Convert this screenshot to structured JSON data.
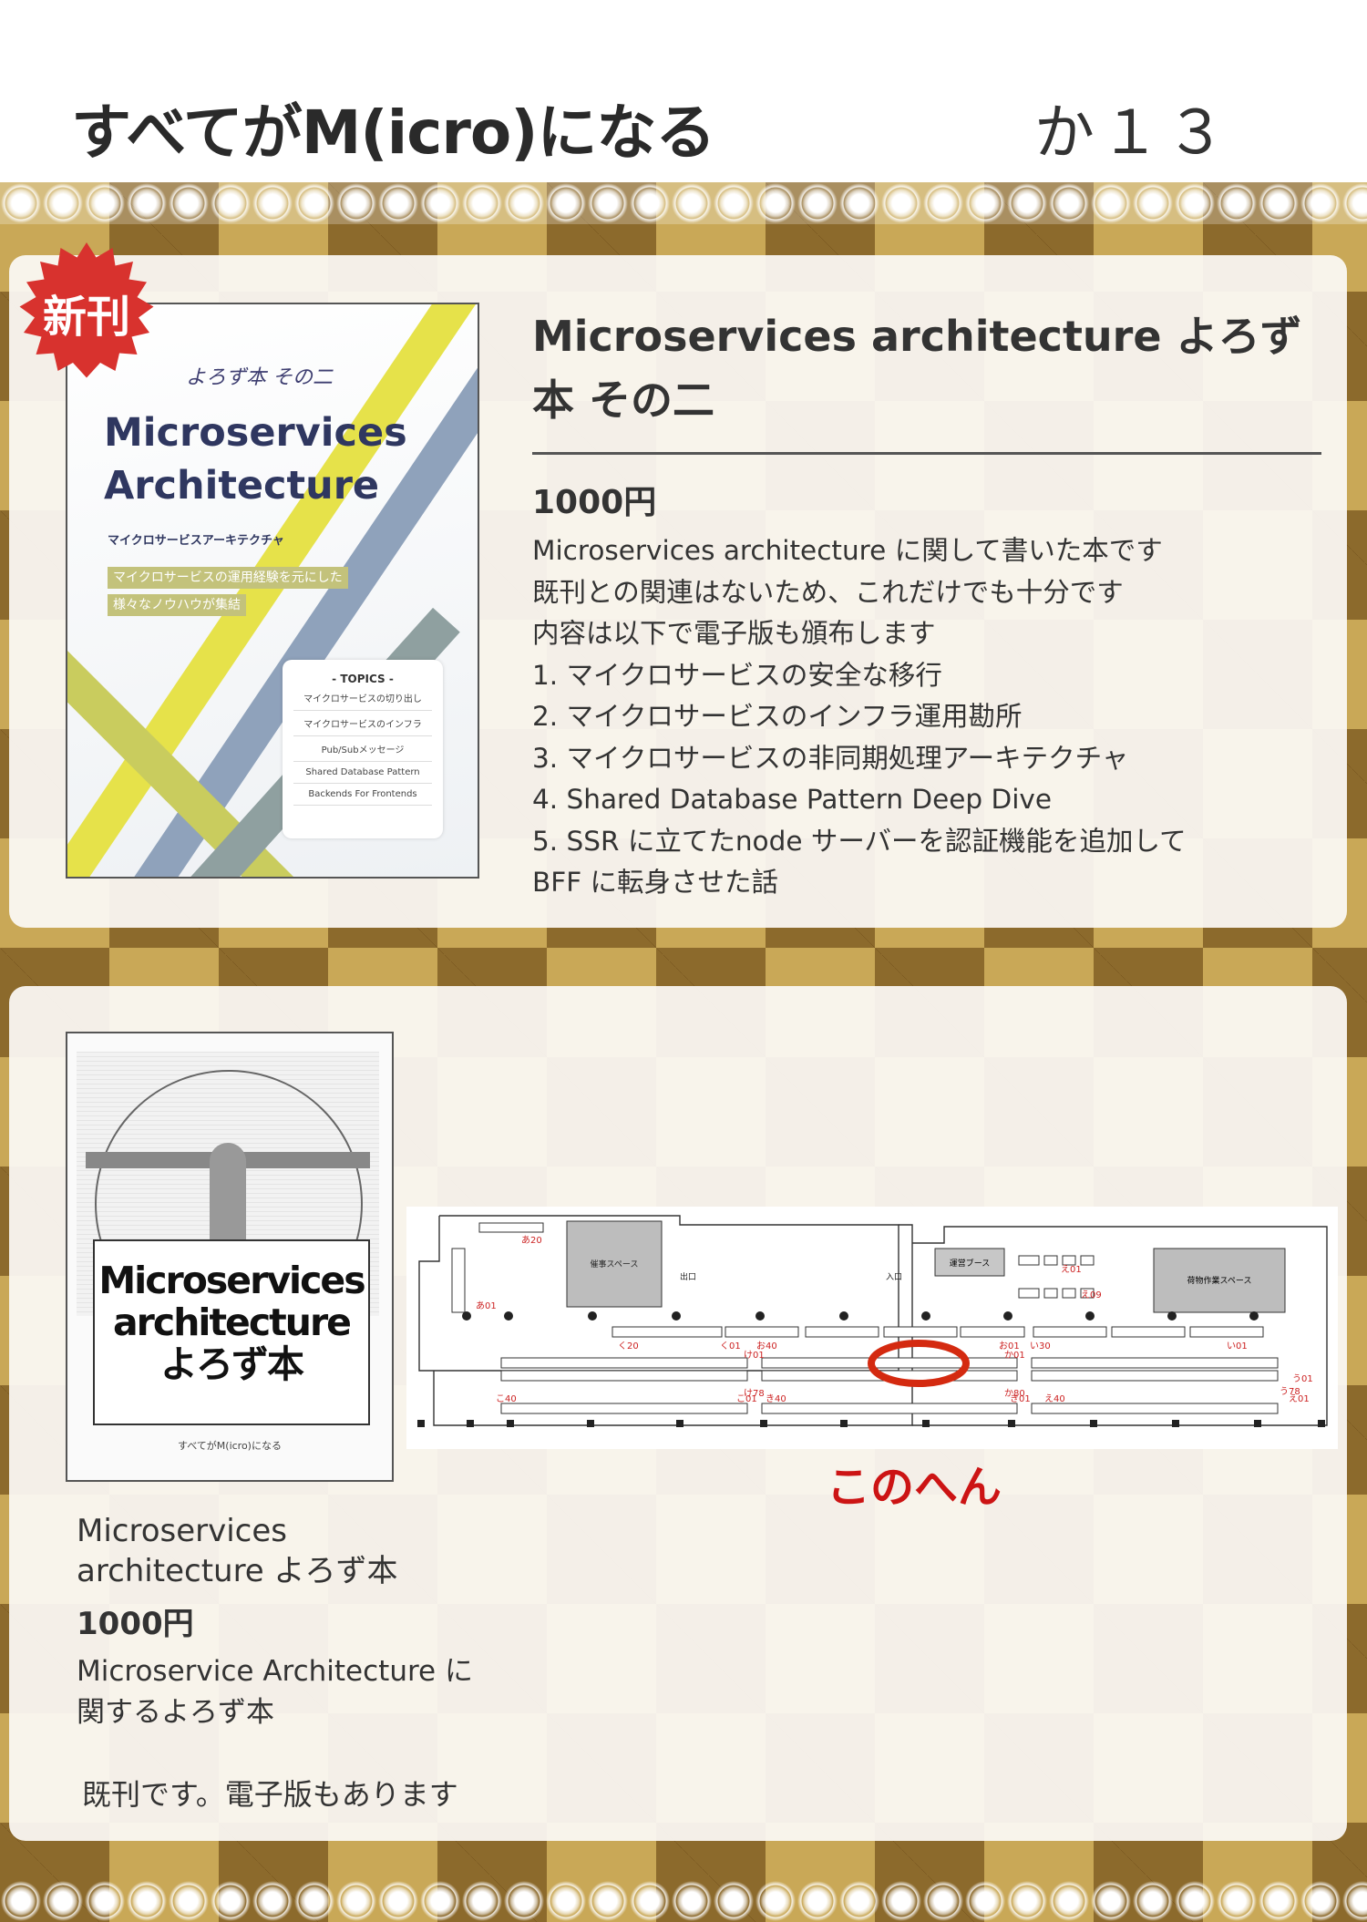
{
  "header": {
    "circle_name": "すべてがM(icro)になる",
    "booth": "か１３"
  },
  "book1": {
    "badge": "新刊",
    "title": "Microservices architecture よろず本 その二",
    "price": "1000円",
    "description": [
      "Microservices architecture に関して書いた本です",
      "既刊との関連はないため、これだけでも十分です",
      "内容は以下で電子版も頒布します",
      "1. マイクロサービスの安全な移行",
      "2. マイクロサービスのインフラ運用勘所",
      "3. マイクロサービスの非同期処理アーキテクチャ",
      "4. Shared Database Pattern Deep Dive",
      "5. SSR に立てたnode サーバーを認証機能を追加して",
      "BFF に転身させた話"
    ],
    "cover": {
      "subtitle": "よろず本 その二",
      "title_line1": "Microservices",
      "title_line2": "Architecture",
      "kana": "マイクロサービスアーキテクチャ",
      "tag1": "マイクロサービスの運用経験を元にした",
      "tag2": "様々なノウハウが集結",
      "topics_heading": "- TOPICS -",
      "topics": [
        "マイクロサービスの切り出し",
        "マイクロサービスのインフラ",
        "Pub/Subメッセージ",
        "Shared Database Pattern",
        "Backends For Frontends"
      ]
    }
  },
  "book2": {
    "title": "Microservices architecture よろず本",
    "price": "1000円",
    "description": "Microservice Architecture に関するよろず本",
    "note": "既刊です。電子版もあります",
    "cover": {
      "title_line1": "Microservices",
      "title_line2": "architecture",
      "title_line3": "よろず本",
      "footer": "すべてがM(icro)になる"
    }
  },
  "map": {
    "caption": "このへん",
    "labels": {
      "event_space": "催事スペース",
      "exit": "出口",
      "entrance": "入口",
      "staff_booth": "運営ブース",
      "cargo_space": "荷物作業スペース",
      "a20": "あ20",
      "a01": "あ01",
      "ku20": "く20",
      "ku01": "く01",
      "o40": "お40",
      "o01": "お01",
      "i30": "い30",
      "i01": "い01",
      "e01": "え01",
      "e09": "え09",
      "ke01": "け01",
      "ke78": "け78",
      "ka01": "か01",
      "ka80": "か80",
      "ko40": "こ40",
      "ko01": "こ01",
      "ki40": "き40",
      "ki01": "き01",
      "e40": "え40",
      "e01b": "え01",
      "u01": "う01",
      "u78": "う78"
    },
    "highlight_color": "#d42a10",
    "accent_color": "#cc2222"
  },
  "colors": {
    "badge": "#d8322e",
    "pattern": "#c9a857"
  }
}
